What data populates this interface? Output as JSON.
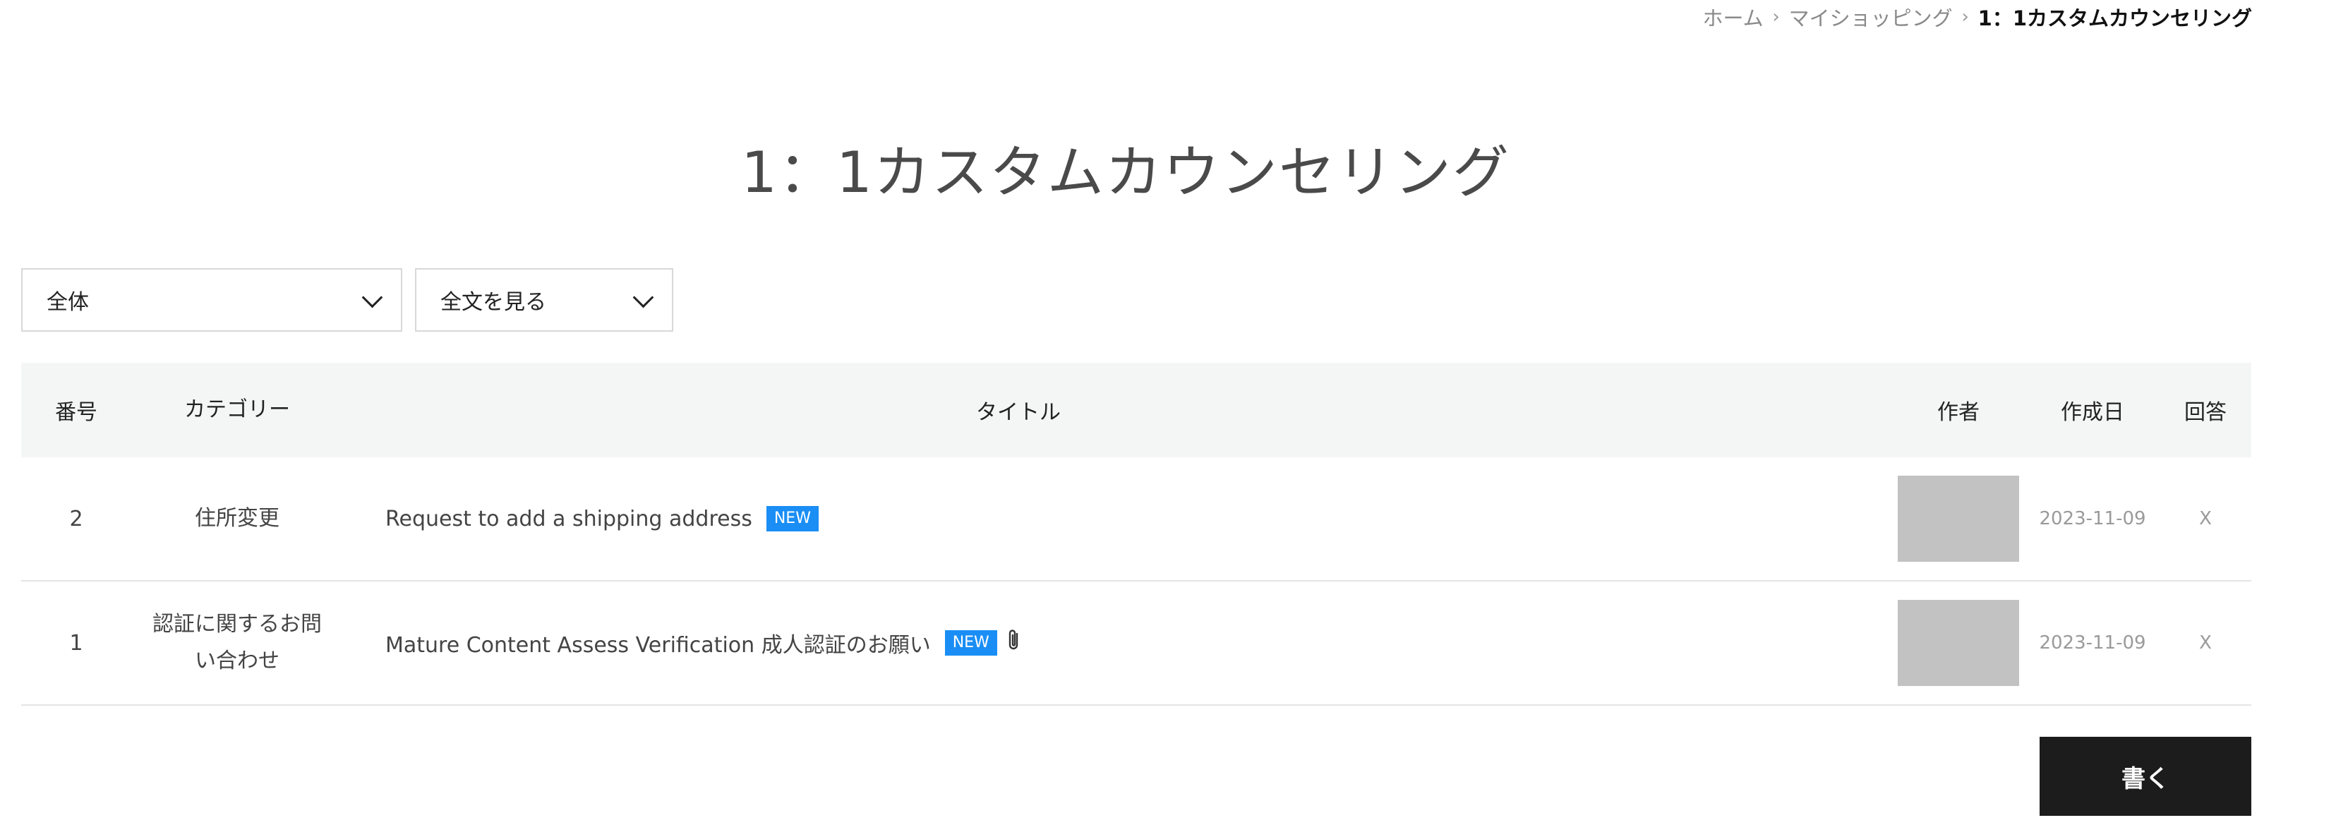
{
  "breadcrumb": {
    "home": "ホーム",
    "myshopping": "マイショッピング",
    "current": "1：1カスタムカウンセリング"
  },
  "page_title": "1：1カスタムカウンセリング",
  "filters": {
    "category": "全体",
    "view": "全文を見る"
  },
  "table": {
    "headers": {
      "no": "番号",
      "category": "カテゴリー",
      "title": "タイトル",
      "author": "作者",
      "date": "作成日",
      "answer": "回答"
    },
    "rows": [
      {
        "no": "2",
        "category": "住所変更",
        "title": "Request to add a shipping address",
        "badge": "NEW",
        "attachment": false,
        "date": "2023-11-09",
        "answer": "X"
      },
      {
        "no": "1",
        "category_line1": "認証に関するお問",
        "category_line2": "い合わせ",
        "title": "Mature Content Assess Verification 成人認証のお願い",
        "badge": "NEW",
        "attachment": true,
        "date": "2023-11-09",
        "answer": "X"
      }
    ]
  },
  "write_button": "書く",
  "icons": {
    "chevron": "chevron-down-icon",
    "attachment": "paperclip-icon",
    "breadcrumb_sep": "chevron-right-icon"
  },
  "colors": {
    "badge": "#1a8ef5",
    "header_bg": "#f4f6f5",
    "button_bg": "#1c1c1c"
  }
}
